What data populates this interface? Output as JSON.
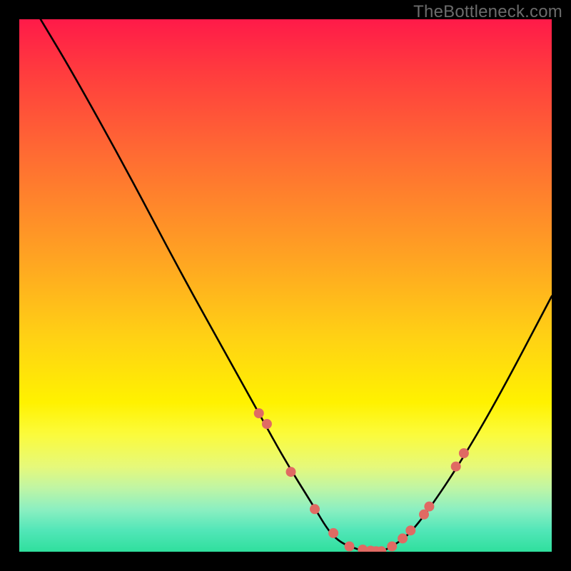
{
  "watermark": "TheBottleneck.com",
  "chart_data": {
    "type": "line",
    "title": "",
    "xlabel": "",
    "ylabel": "",
    "xlim": [
      0,
      100
    ],
    "ylim": [
      0,
      100
    ],
    "series": [
      {
        "name": "bottleneck-curve",
        "x": [
          4,
          10,
          20,
          30,
          40,
          45,
          50,
          55,
          58,
          60,
          62,
          65,
          68,
          70,
          73,
          77,
          83,
          90,
          100
        ],
        "y": [
          100,
          90,
          72,
          53,
          35,
          26,
          17,
          9,
          4,
          2,
          1,
          0,
          0,
          1,
          3,
          8,
          17,
          29,
          48
        ]
      }
    ],
    "markers": {
      "name": "highlight-points",
      "color": "#e06a63",
      "x": [
        45,
        46.5,
        51,
        55.5,
        59,
        62,
        64.5,
        66,
        67,
        68,
        70,
        72,
        73.5,
        76,
        77,
        82,
        83.5
      ],
      "y": [
        26,
        24,
        15,
        8,
        3.5,
        1,
        0.4,
        0.2,
        0.1,
        0.1,
        1,
        2.5,
        4,
        7,
        8.5,
        16,
        18.5
      ]
    },
    "gradient_stops": [
      {
        "pos": 0,
        "color": "#ff1a49"
      },
      {
        "pos": 25,
        "color": "#ff6a33"
      },
      {
        "pos": 60,
        "color": "#ffd214"
      },
      {
        "pos": 78,
        "color": "#fbfb3c"
      },
      {
        "pos": 92,
        "color": "#8cefc1"
      },
      {
        "pos": 100,
        "color": "#2fdf9d"
      }
    ]
  }
}
